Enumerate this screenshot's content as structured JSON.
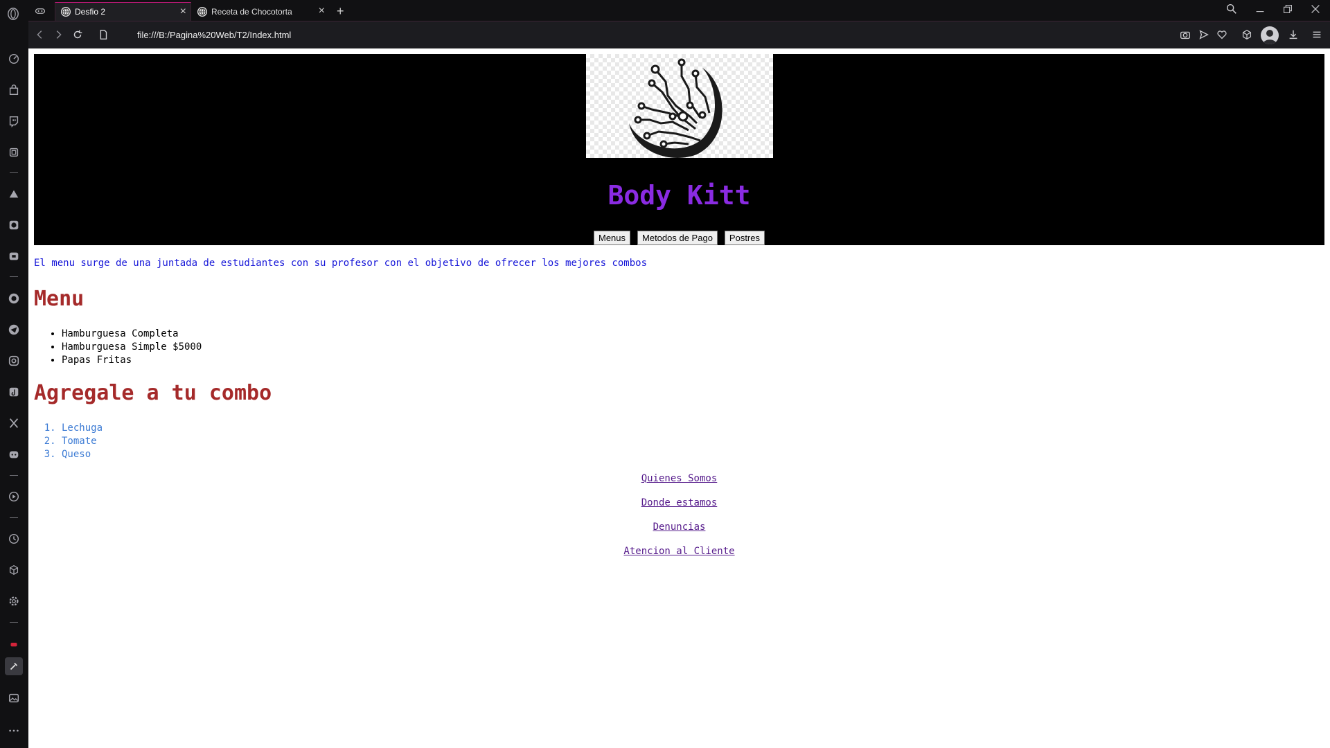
{
  "browser": {
    "tabs": [
      {
        "title": "Desfio 2",
        "active": true
      },
      {
        "title": "Receta de Chocotorta",
        "active": false
      }
    ],
    "new_tab_symbol": "+",
    "close_symbol": "×",
    "address": "file:///B:/Pagina%20Web/T2/Index.html",
    "accent_color": "#c2187a",
    "sidebar_icons": [
      "speed-dial-icon",
      "shopping-bag-icon",
      "twitch-icon",
      "extensions-icon",
      "aria-icon",
      "messenger-icon",
      "game-icon",
      "whatsapp-icon",
      "telegram-icon",
      "instagram-icon",
      "tiktok-icon",
      "x-icon",
      "discord-icon",
      "player-icon",
      "history-icon",
      "cube-icon",
      "settings-icon",
      "notification-icon",
      "tools-icon",
      "gallery-icon",
      "more-icon"
    ],
    "toolbar_right_icons": [
      "camera-icon",
      "send-icon",
      "heart-icon",
      "cube-icon",
      "avatar",
      "download-icon",
      "menu-icon"
    ]
  },
  "page": {
    "title": "Body Kitt",
    "logo_name": "circuit-tree-logo",
    "nav_buttons": [
      "Menus",
      "Metodos de Pago",
      "Postres"
    ],
    "intro": "El menu surge de una juntada de estudiantes con su profesor con el objetivo de ofrecer los mejores combos",
    "menu_heading": "Menu",
    "menu_items": [
      "Hamburguesa Completa",
      "Hamburguesa Simple $5000",
      "Papas Fritas"
    ],
    "combo_heading": "Agregale a tu combo",
    "combo_items": [
      "Lechuga",
      "Tomate",
      "Queso"
    ],
    "footer_links": [
      "Quienes Somos",
      "Donde estamos",
      "Denuncias",
      "Atencion al Cliente"
    ],
    "colors": {
      "header_bg": "#000000",
      "title": "#8a2be2",
      "intro": "#1515d8",
      "headings": "#a52a2a",
      "combo_items": "#3c7bd4",
      "links": "#551a8b"
    }
  }
}
